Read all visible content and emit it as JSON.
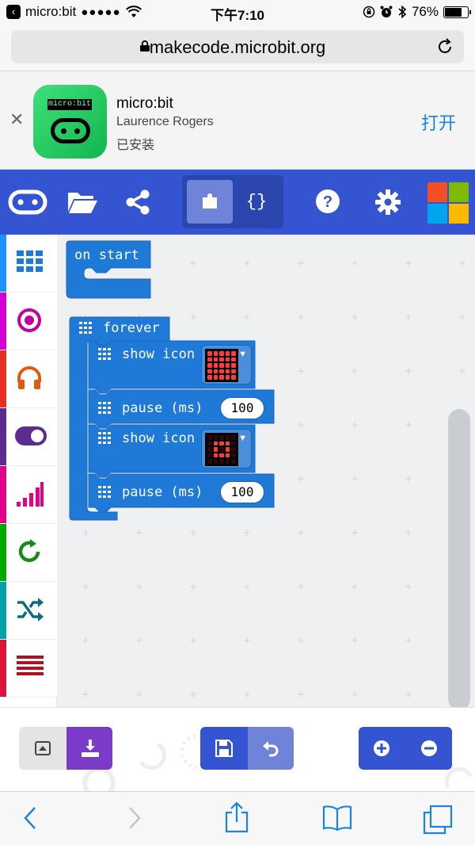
{
  "status_bar": {
    "carrier": "micro:bit",
    "signal": "●●●●●",
    "time": "下午7:10",
    "battery": "76%",
    "battery_level": 0.76
  },
  "browser": {
    "url": "makecode.microbit.org"
  },
  "app_banner": {
    "app_name": "micro:bit",
    "developer": "Laurence Rogers",
    "status": "已安装",
    "open_label": "打开",
    "logo_text": "micro:bit"
  },
  "toolbar": {
    "js_label": "{}"
  },
  "blocks": {
    "on_start": "on start",
    "forever": "forever",
    "show_icon_1": "show icon",
    "pause_1": "pause (ms)",
    "pause_1_value": "100",
    "show_icon_2": "show icon",
    "pause_2": "pause (ms)",
    "pause_2_value": "100"
  },
  "colors": {
    "header": "#3454d1",
    "block_blue": "#1e7ad6",
    "block_dark": "#1c64b8",
    "toolbox_basic": "#1e90ff",
    "toolbox_input": "#d400d4",
    "toolbox_music": "#e63022",
    "toolbox_led": "#5c2d91",
    "toolbox_radio": "#e3008c",
    "toolbox_loops": "#00aa00",
    "toolbox_logic": "#00a4a6",
    "toolbox_variables": "#dc143c"
  }
}
